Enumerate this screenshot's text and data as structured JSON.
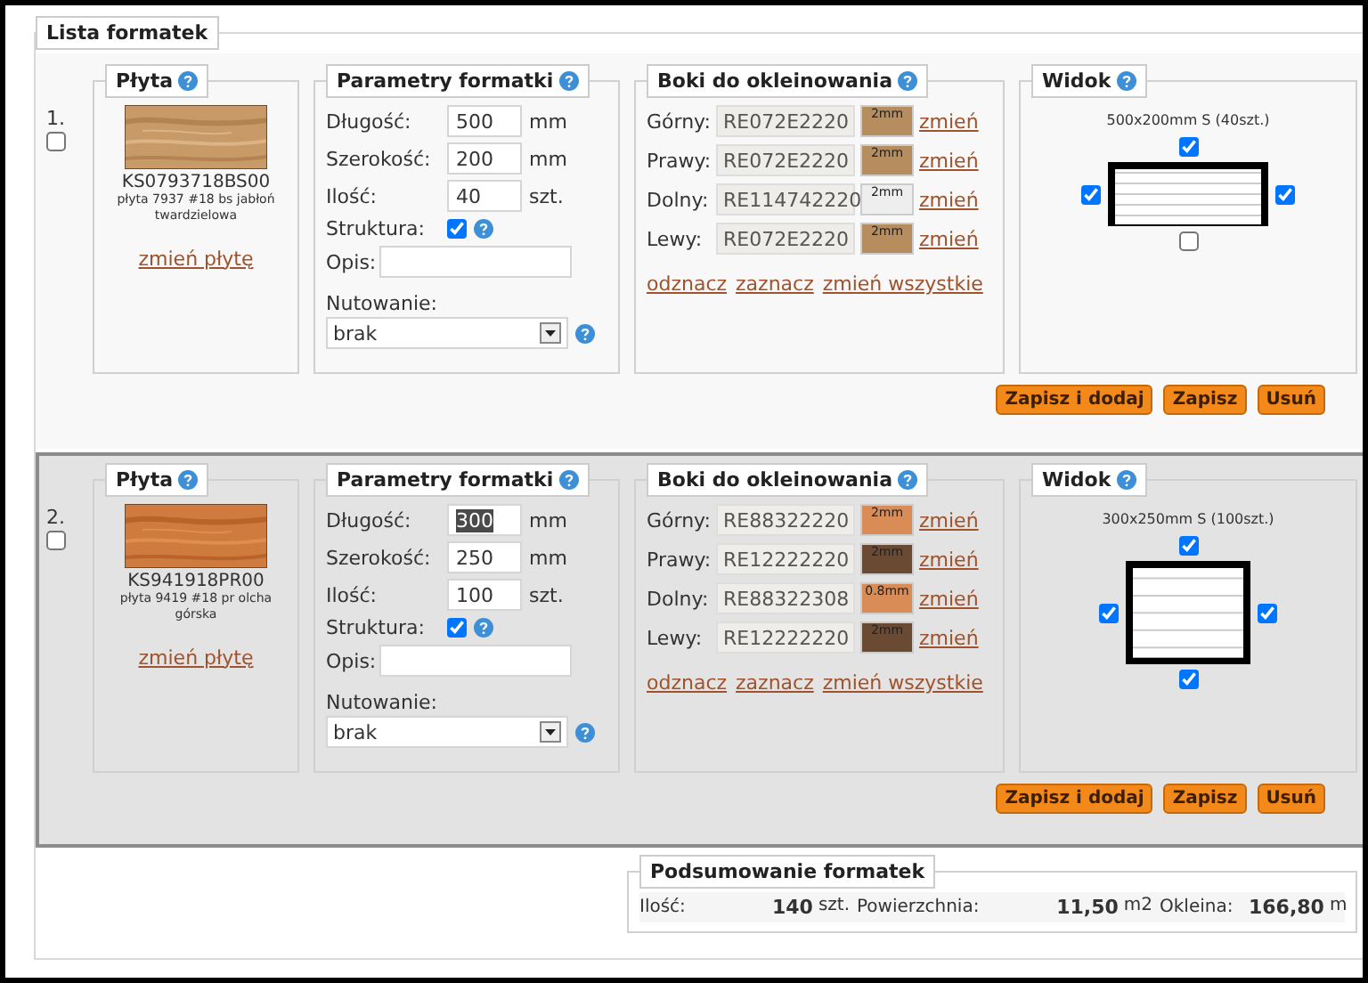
{
  "section_title": "Lista formatek",
  "rows": [
    {
      "number": "1.",
      "checked": false,
      "active": false,
      "board": {
        "title": "Płyta",
        "code": "KS0793718BS00",
        "description": "płyta 7937 #18 bs jabłoń twardzielowa",
        "change_link": "zmień płytę"
      },
      "params": {
        "title": "Parametry formatki",
        "fields": [
          {
            "label": "Długość:",
            "value": "500",
            "unit": "mm",
            "highlighted": false
          },
          {
            "label": "Szerokość:",
            "value": "200",
            "unit": "mm",
            "highlighted": false
          },
          {
            "label": "Ilość:",
            "value": "40",
            "unit": "szt.",
            "highlighted": false
          }
        ],
        "structure": {
          "label": "Struktura:",
          "checked": true
        },
        "description": {
          "label": "Opis:"
        },
        "grooving": {
          "label": "Nutowanie:",
          "value": "brak"
        }
      },
      "edges": {
        "title": "Boki do okleinowania",
        "items": [
          {
            "label": "Górny:",
            "code": "RE072E2220",
            "thickness": "2mm",
            "color": "#b58d5e",
            "link": "zmień"
          },
          {
            "label": "Prawy:",
            "code": "RE072E2220",
            "thickness": "2mm",
            "color": "#b58d5e",
            "link": "zmień"
          },
          {
            "label": "Dolny:",
            "code": "RE114742220",
            "thickness": "2mm",
            "color": "#eeeeee",
            "link": "zmień"
          },
          {
            "label": "Lewy:",
            "code": "RE072E2220",
            "thickness": "2mm",
            "color": "#b58d5e",
            "link": "zmień"
          }
        ],
        "links": [
          "odznacz",
          "zaznacz",
          "zmień wszystkie"
        ]
      },
      "view": {
        "title": "Widok",
        "caption": "500x200mm S (40szt.)",
        "top": true,
        "right": true,
        "bottom": false,
        "left": true
      },
      "buttons": [
        "Zapisz i dodaj",
        "Zapisz",
        "Usuń"
      ]
    },
    {
      "number": "2.",
      "checked": false,
      "active": true,
      "board": {
        "title": "Płyta",
        "code": "KS941918PR00",
        "description": "płyta 9419 #18 pr olcha górska",
        "change_link": "zmień płytę"
      },
      "params": {
        "title": "Parametry formatki",
        "fields": [
          {
            "label": "Długość:",
            "value": "300",
            "unit": "mm",
            "highlighted": true
          },
          {
            "label": "Szerokość:",
            "value": "250",
            "unit": "mm",
            "highlighted": false
          },
          {
            "label": "Ilość:",
            "value": "100",
            "unit": "szt.",
            "highlighted": false
          }
        ],
        "structure": {
          "label": "Struktura:",
          "checked": true
        },
        "description": {
          "label": "Opis:"
        },
        "grooving": {
          "label": "Nutowanie:",
          "value": "brak"
        }
      },
      "edges": {
        "title": "Boki do okleinowania",
        "items": [
          {
            "label": "Górny:",
            "code": "RE88322220",
            "thickness": "2mm",
            "color": "#d98c56",
            "link": "zmień"
          },
          {
            "label": "Prawy:",
            "code": "RE12222220",
            "thickness": "2mm",
            "color": "#6b4a33",
            "link": "zmień"
          },
          {
            "label": "Dolny:",
            "code": "RE88322308",
            "thickness": "0.8mm",
            "color": "#d98c56",
            "link": "zmień"
          },
          {
            "label": "Lewy:",
            "code": "RE12222220",
            "thickness": "2mm",
            "color": "#6b4a33",
            "link": "zmień"
          }
        ],
        "links": [
          "odznacz",
          "zaznacz",
          "zmień wszystkie"
        ]
      },
      "view": {
        "title": "Widok",
        "caption": "300x250mm S (100szt.)",
        "top": true,
        "right": true,
        "bottom": true,
        "left": true
      },
      "buttons": [
        "Zapisz i dodaj",
        "Zapisz",
        "Usuń"
      ]
    }
  ],
  "summary": {
    "title": "Podsumowanie formatek",
    "items": [
      {
        "label": "Ilość:",
        "value": "140",
        "unit": "szt."
      },
      {
        "label": "Powierzchnia:",
        "value": "11,50",
        "unit": "m2"
      },
      {
        "label": "Okleina:",
        "value": "166,80",
        "unit": "m"
      }
    ]
  }
}
